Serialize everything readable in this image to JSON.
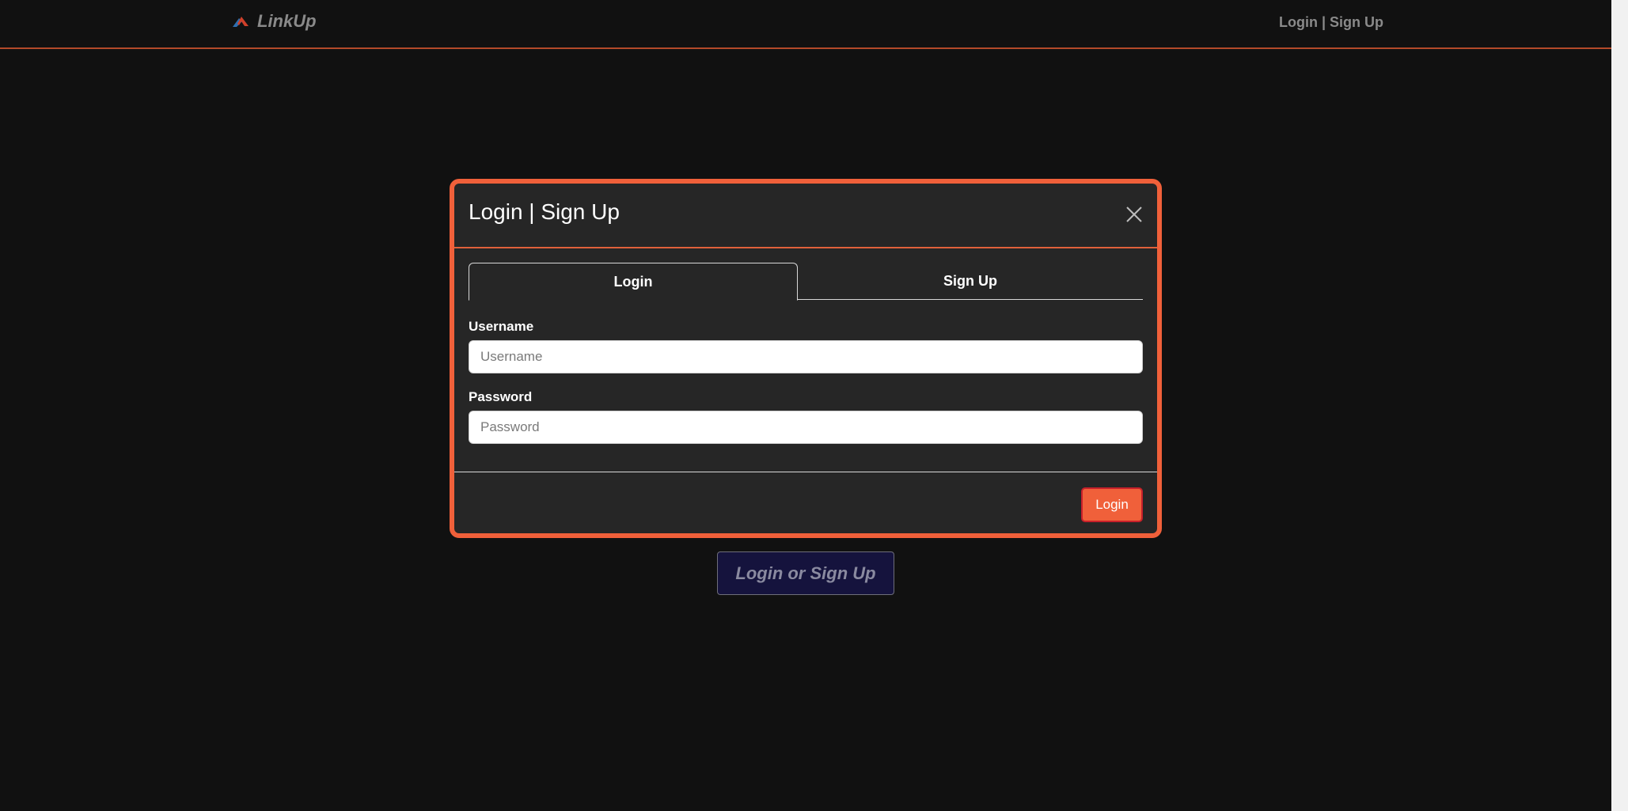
{
  "navbar": {
    "brand_name": "LinkUp",
    "brand_icon": "linkup-logo-icon",
    "auth_link": "Login | Sign Up"
  },
  "main": {
    "cta_label": "Login or Sign Up"
  },
  "modal": {
    "title": "Login | Sign Up",
    "close_icon": "close-icon",
    "tabs": [
      {
        "label": "Login",
        "active": true
      },
      {
        "label": "Sign Up",
        "active": false
      }
    ],
    "fields": {
      "username": {
        "label": "Username",
        "placeholder": "Username",
        "value": ""
      },
      "password": {
        "label": "Password",
        "placeholder": "Password",
        "value": ""
      }
    },
    "submit_label": "Login"
  },
  "colors": {
    "background": "#111111",
    "modal_background": "#262626",
    "accent": "#f0603a",
    "submit_border": "#c8202a",
    "cta_background": "#15133d",
    "muted_text": "#8a8a8a"
  }
}
